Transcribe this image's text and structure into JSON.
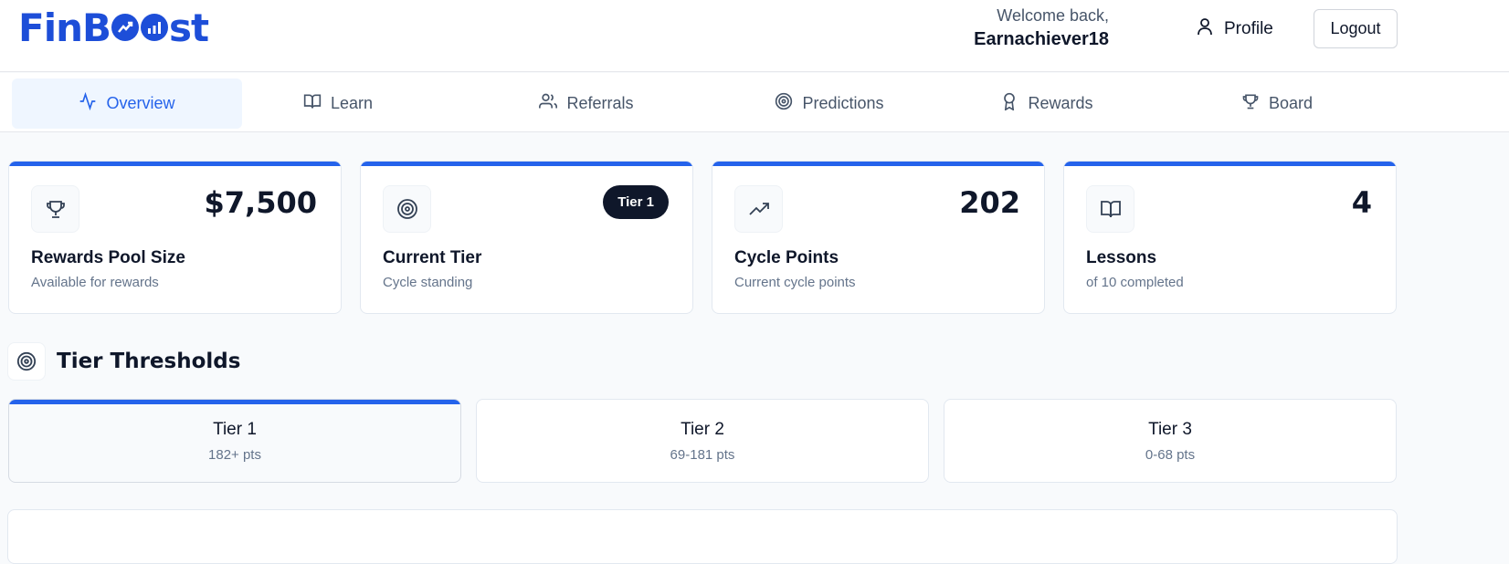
{
  "brand": {
    "logo_text_a": "FinB",
    "logo_text_b": "st",
    "accent": "#2563eb"
  },
  "header": {
    "welcome_line": "Welcome back,",
    "username": "Earnachiever18",
    "profile_label": "Profile",
    "logout_label": "Logout"
  },
  "tabs": [
    {
      "label": "Overview",
      "icon": "activity-icon",
      "active": true
    },
    {
      "label": "Learn",
      "icon": "book-icon"
    },
    {
      "label": "Referrals",
      "icon": "users-icon"
    },
    {
      "label": "Predictions",
      "icon": "target-icon"
    },
    {
      "label": "Rewards",
      "icon": "award-icon"
    },
    {
      "label": "Board",
      "icon": "trophy-icon"
    }
  ],
  "stats": [
    {
      "value": "$7,500",
      "title": "Rewards Pool Size",
      "sub": "Available for rewards",
      "icon": "trophy-icon"
    },
    {
      "badge": "Tier 1",
      "title": "Current Tier",
      "sub": "Cycle standing",
      "icon": "target-icon"
    },
    {
      "value": "202",
      "title": "Cycle Points",
      "sub": "Current cycle points",
      "icon": "trending-up-icon"
    },
    {
      "value": "4",
      "title": "Lessons",
      "sub": "of 10 completed",
      "icon": "book-icon"
    }
  ],
  "thresholds": {
    "title": "Tier Thresholds",
    "tiers": [
      {
        "name": "Tier 1",
        "points": "182+ pts",
        "active": true
      },
      {
        "name": "Tier 2",
        "points": "69-181 pts"
      },
      {
        "name": "Tier 3",
        "points": "0-68 pts"
      }
    ]
  }
}
